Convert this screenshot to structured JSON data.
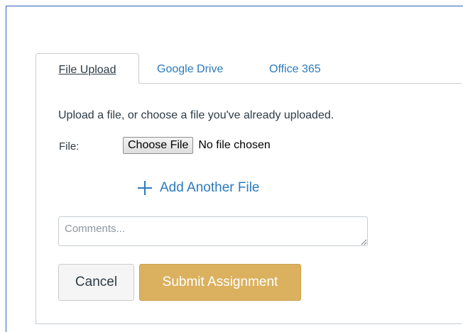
{
  "tabs": [
    {
      "label": "File Upload",
      "active": true
    },
    {
      "label": "Google Drive",
      "active": false
    },
    {
      "label": "Office 365",
      "active": false
    }
  ],
  "upload": {
    "instructions": "Upload a file, or choose a file you've already uploaded.",
    "file_label": "File:",
    "choose_button_label": "Choose File",
    "no_file_text": "No file chosen",
    "add_another_label": "Add Another File"
  },
  "comments": {
    "placeholder": "Comments...",
    "value": ""
  },
  "actions": {
    "cancel_label": "Cancel",
    "submit_label": "Submit Assignment"
  },
  "colors": {
    "link": "#2b7abc",
    "submit_bg": "#dbb15f",
    "border": "#c7cdd1",
    "frame_border": "#2f63b7"
  }
}
